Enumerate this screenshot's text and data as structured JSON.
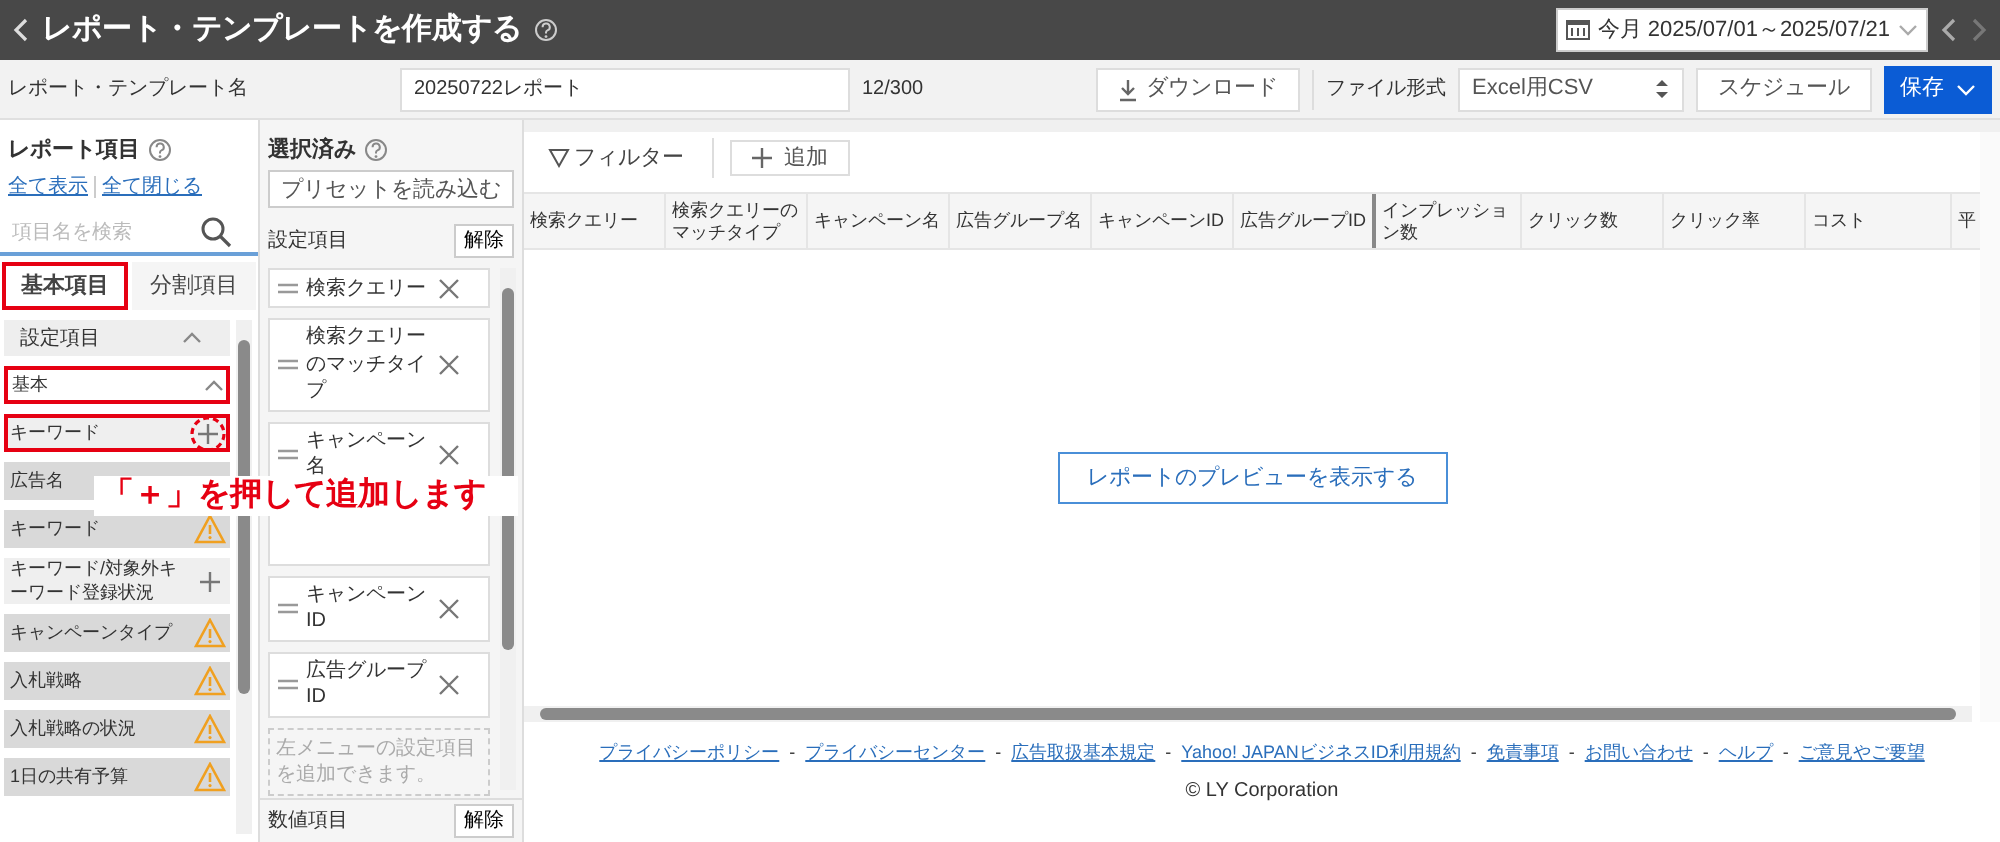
{
  "header": {
    "title": "レポート・テンプレートを作成する",
    "date_range": "今月 2025/07/01～2025/07/21"
  },
  "toolbar": {
    "name_label": "レポート・テンプレート名",
    "name_value": "20250722レポート",
    "counter": "12/300",
    "download": "ダウンロード",
    "format_label": "ファイル形式",
    "format_value": "Excel用CSV",
    "schedule": "スケジュール",
    "save": "保存"
  },
  "report_items": {
    "title": "レポート項目",
    "expand_all": "全て表示",
    "collapse_all": "全て閉じる",
    "search_placeholder": "項目名を検索",
    "tabs": [
      {
        "label": "基本項目",
        "selected": true,
        "highlighted": true
      },
      {
        "label": "分割項目",
        "selected": false,
        "highlighted": false
      }
    ],
    "section": "設定項目",
    "group": {
      "label": "基本",
      "highlighted": true
    },
    "items": [
      {
        "label": "キーワード",
        "kind": "add",
        "highlighted": true
      },
      {
        "label": "広告名",
        "kind": "plain",
        "highlighted": false
      },
      {
        "label": "キーワード",
        "kind": "warning",
        "highlighted": false
      },
      {
        "label": "キーワード/対象外キーワード登録状況",
        "kind": "add",
        "highlighted": false
      },
      {
        "label": "キャンペーンタイプ",
        "kind": "warning",
        "highlighted": false
      },
      {
        "label": "入札戦略",
        "kind": "warning",
        "highlighted": false
      },
      {
        "label": "入札戦略の状況",
        "kind": "warning",
        "highlighted": false
      },
      {
        "label": "1日の共有予算",
        "kind": "warning",
        "highlighted": false
      }
    ]
  },
  "selected_panel": {
    "title": "選択済み",
    "preset": "プリセットを読み込む",
    "section": "設定項目",
    "clear": "解除",
    "items": [
      {
        "kind": "item",
        "label": "検索クエリー"
      },
      {
        "kind": "item",
        "label": "検索クエリーのマッチタイプ"
      },
      {
        "kind": "item",
        "label": "キャンペーン名"
      },
      {
        "kind": "covered"
      },
      {
        "kind": "item",
        "label": "キャンペーンID"
      },
      {
        "kind": "item",
        "label": "広告グループID"
      }
    ],
    "hint": "左メニューの設定項目を追加できます。",
    "numeric_section": "数値項目",
    "numeric_clear": "解除"
  },
  "preview": {
    "filter": "フィルター",
    "add": "追加",
    "columns": [
      "検索クエリー",
      "検索クエリーのマッチタイプ",
      "キャンペーン名",
      "広告グループ名",
      "キャンペーンID",
      "広告グループID",
      "インプレッション数",
      "クリック数",
      "クリック率",
      "コスト",
      "平"
    ],
    "preview_button": "レポートのプレビューを表示する"
  },
  "callout": {
    "text": "「＋」を押して追加します"
  },
  "footer": {
    "separator": "-",
    "links": [
      "プライバシーポリシー",
      "プライバシーセンター",
      "広告取扱基本規定",
      "Yahoo! JAPANビジネスID利用規約",
      "免責事項",
      "お問い合わせ",
      "ヘルプ",
      "ご意見やご要望"
    ],
    "copyright": "© LY Corporation"
  }
}
